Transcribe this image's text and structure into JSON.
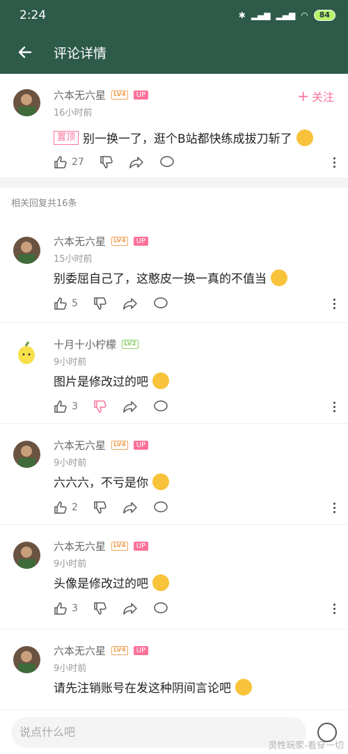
{
  "status_bar": {
    "time": "2:24",
    "battery": "84"
  },
  "header": {
    "title": "评论详情"
  },
  "main_comment": {
    "username": "六本无六星",
    "level": "LV4",
    "up_badge": "UP",
    "time": "16小时前",
    "pin_label": "置顶",
    "text": "别一换一了，逛个B站都快练成拔刀斩了",
    "likes": "27",
    "follow_label": "关注"
  },
  "reply_count_text": "相关回复共16条",
  "replies": [
    {
      "username": "六本无六星",
      "level": "LV4",
      "up_badge": "UP",
      "time": "15小时前",
      "text": "别委屈自己了，这憨皮一换一真的不值当",
      "likes": "5"
    },
    {
      "username": "十月十小柠檬",
      "level": "LV2",
      "time": "9小时前",
      "text": "图片是修改过的吧",
      "likes": "3"
    },
    {
      "username": "六本无六星",
      "level": "LV4",
      "up_badge": "UP",
      "time": "9小时前",
      "text": "六六六，不亏是你",
      "likes": "2"
    },
    {
      "username": "六本无六星",
      "level": "LV4",
      "up_badge": "UP",
      "time": "9小时前",
      "text": "头像是修改过的吧",
      "likes": "3"
    },
    {
      "username": "六本无六星",
      "level": "LV4",
      "up_badge": "UP",
      "time": "9小时前",
      "text": "请先注销账号在发这种阴间言论吧"
    }
  ],
  "input": {
    "placeholder": "说点什么吧"
  },
  "watermark": "灵性玩家-看穿一切",
  "colors": {
    "header": "#2e5a49",
    "accent": "#fb7299",
    "lv4": "#f0a35a",
    "lv2": "#8ccf6a"
  },
  "icons": [
    "back-arrow-icon",
    "thumb-up-icon",
    "thumb-down-icon",
    "share-icon",
    "comment-icon",
    "more-icon",
    "emoji-icon"
  ]
}
